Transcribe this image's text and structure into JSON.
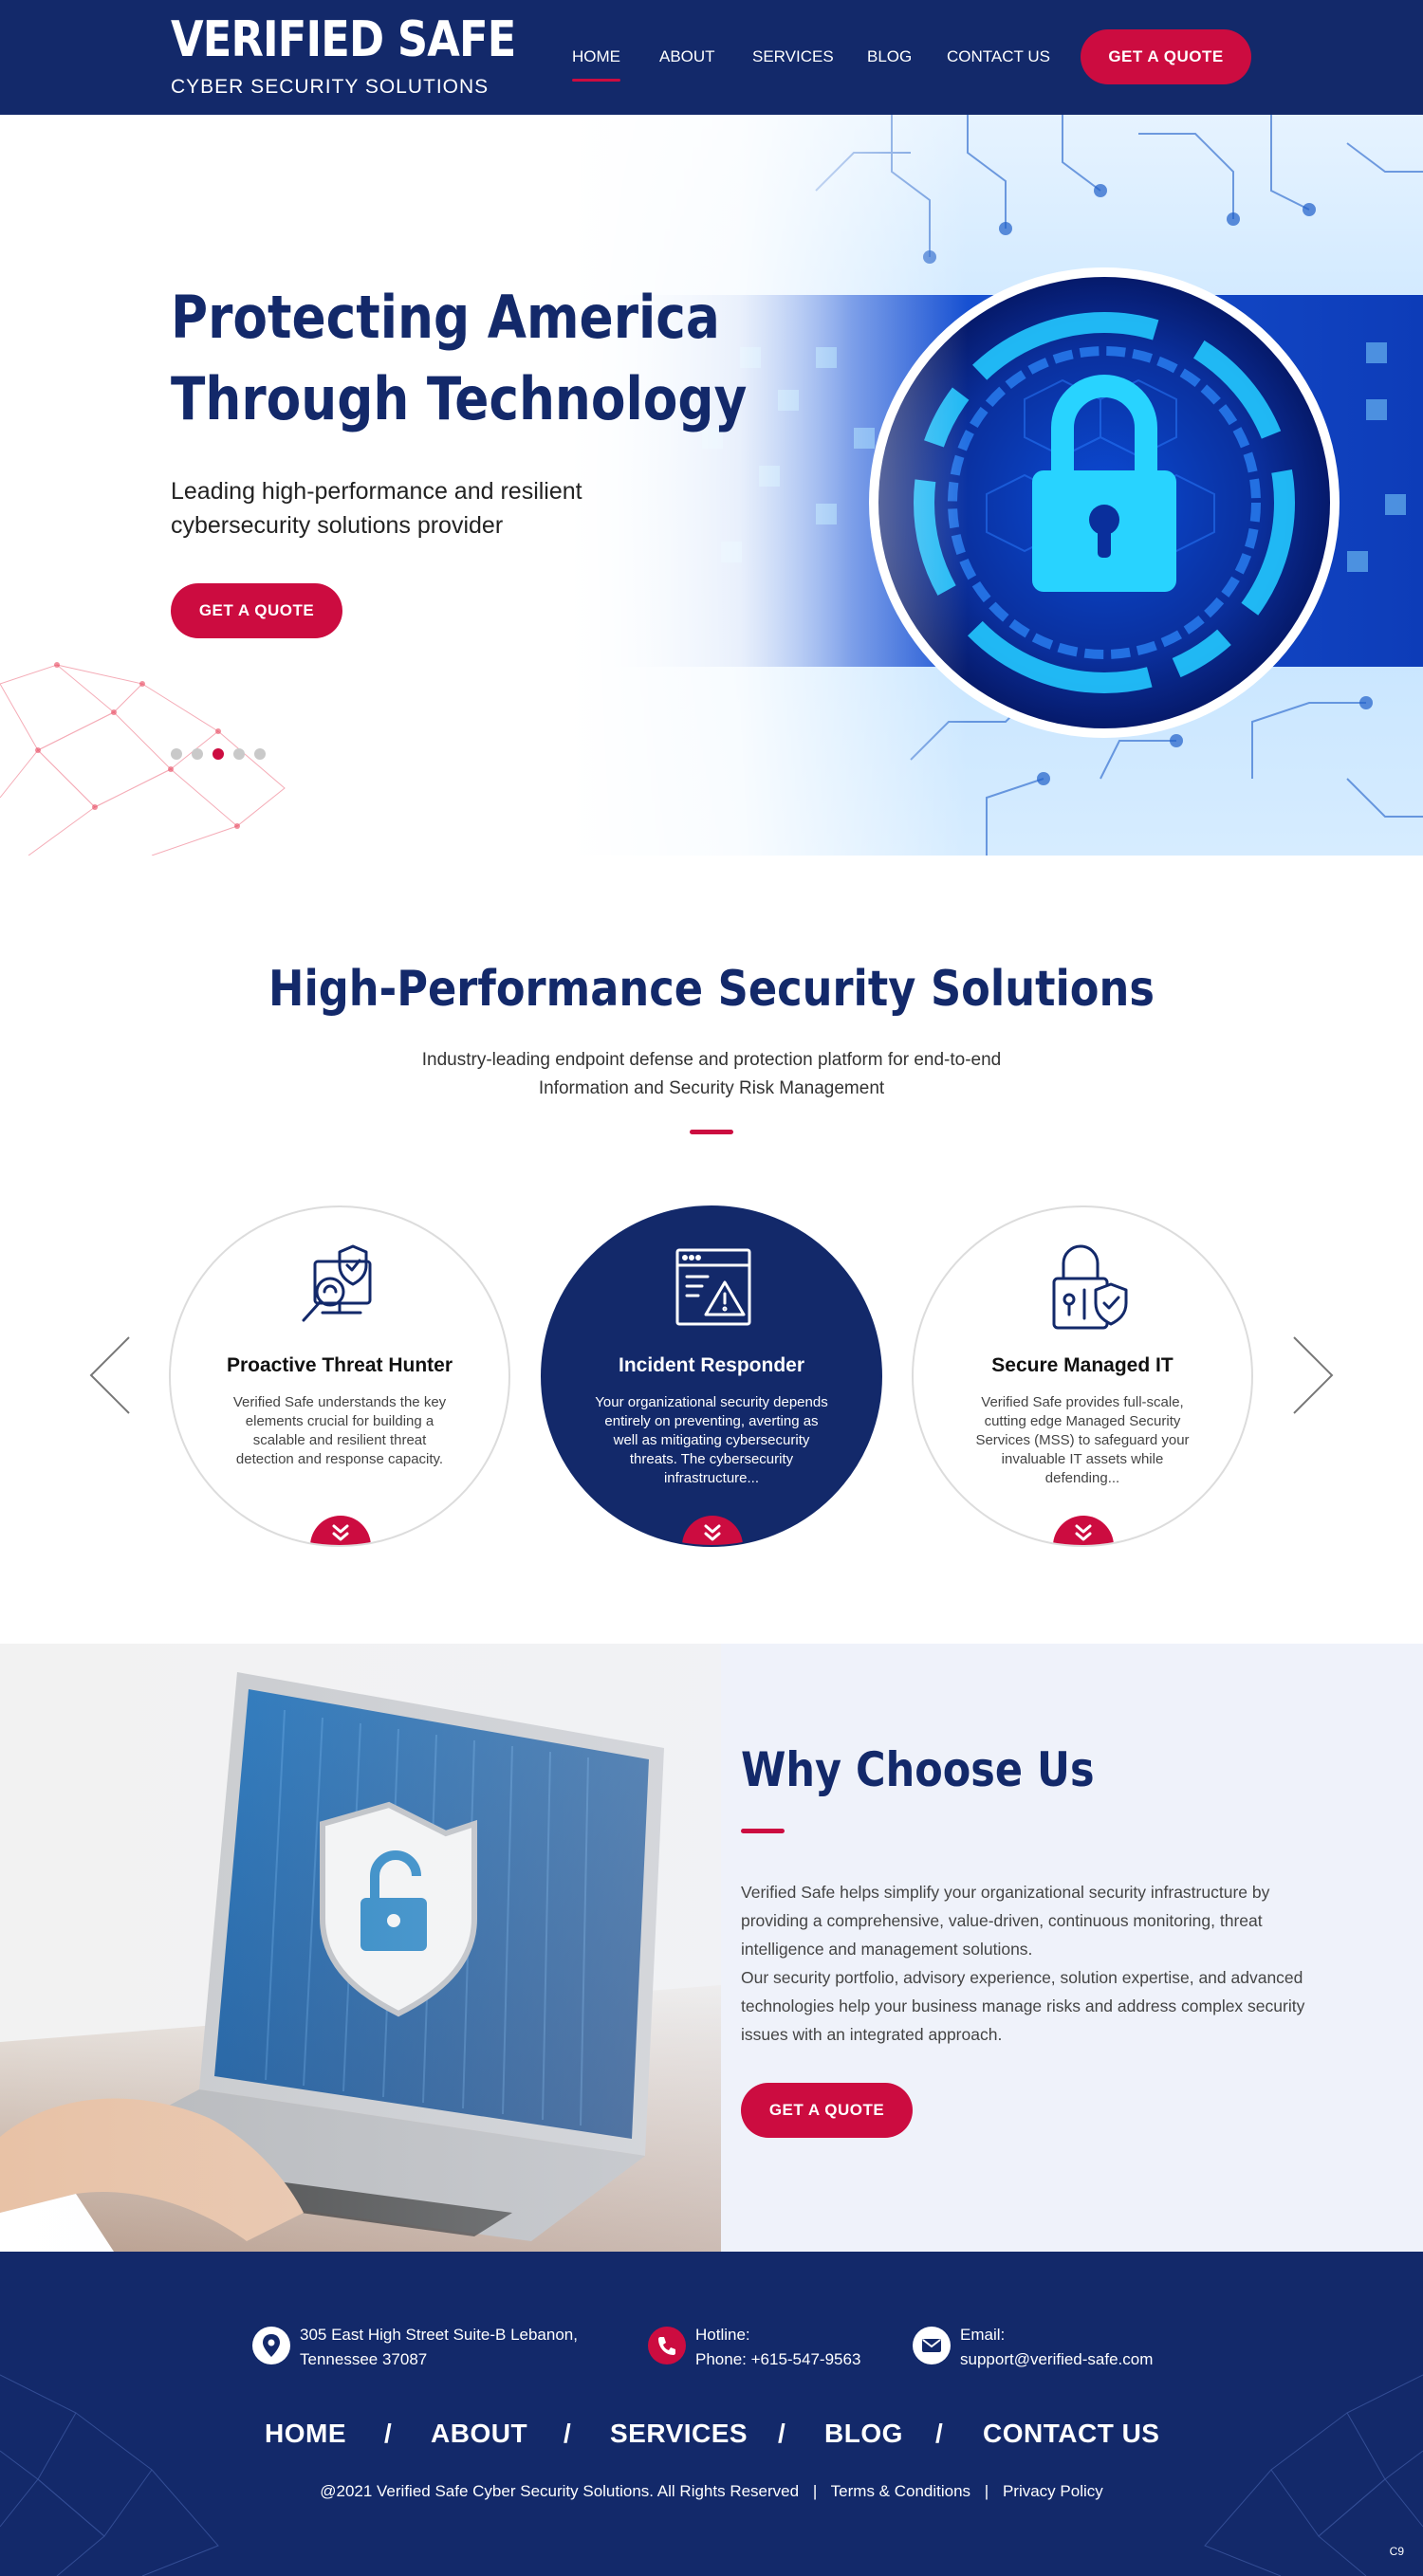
{
  "header": {
    "brand_title": "VERIFIED SAFE",
    "brand_subtitle": "CYBER SECURITY SOLUTIONS",
    "nav": [
      "HOME",
      "ABOUT",
      "SERVICES",
      "BLOG",
      "CONTACT US"
    ],
    "active_nav": "HOME",
    "quote_button": "GET A QUOTE"
  },
  "hero": {
    "title_line1": "Protecting America",
    "title_line2": "Through Technology",
    "subtitle_line1": "Leading high-performance and resilient",
    "subtitle_line2": "cybersecurity solutions provider",
    "quote_button": "GET A QUOTE",
    "slides": 5,
    "active_slide": 3,
    "image_icon": "padlock-circuit-icon"
  },
  "solutions": {
    "title": "High-Performance Security Solutions",
    "description_line1": "Industry-leading endpoint defense and protection platform for end-to-end",
    "description_line2": "Information and Security Risk Management",
    "cards": [
      {
        "title": "Proactive Threat Hunter",
        "text": "Verified Safe understands the key elements crucial for building a scalable and resilient threat detection and response capacity.",
        "icon": "threat-hunter-icon"
      },
      {
        "title": "Incident Responder",
        "text": "Your organizational security depends entirely on preventing, averting as well as mitigating cybersecurity threats. The cybersecurity infrastructure...",
        "icon": "alert-window-icon"
      },
      {
        "title": "Secure Managed IT",
        "text": "Verified Safe provides full-scale, cutting edge Managed Security Services (MSS) to safeguard your invaluable IT assets while defending...",
        "icon": "lock-shield-icon"
      }
    ]
  },
  "why": {
    "title": "Why Choose Us",
    "paragraph1": "Verified Safe helps simplify your organizational security infrastructure by providing a comprehensive, value-driven, continuous monitoring, threat intelligence and management solutions.",
    "paragraph2": "Our security portfolio, advisory experience, solution expertise, and advanced technologies help your business manage risks and address complex security issues with an integrated approach.",
    "quote_button": "GET A QUOTE",
    "image_icon": "laptop-shield-icon"
  },
  "footer": {
    "address_line1": "305 East High Street Suite-B Lebanon,",
    "address_line2": "Tennessee 37087",
    "hotline_label": "Hotline:",
    "hotline": "Phone: +615-547-9563",
    "email_label": "Email:",
    "email": "support@verified-safe.com",
    "nav": [
      "HOME",
      "ABOUT",
      "SERVICES",
      "BLOG",
      "CONTACT US"
    ],
    "separator": "/",
    "copyright": "@2021 Verified Safe Cyber Security Solutions. All Rights Reserved",
    "terms": "Terms & Conditions",
    "privacy": "Privacy Policy",
    "pipe": "|",
    "badge": "C9"
  },
  "colors": {
    "navy": "#13296a",
    "accent": "#cc0c40",
    "light_bg": "#eff2fa"
  }
}
